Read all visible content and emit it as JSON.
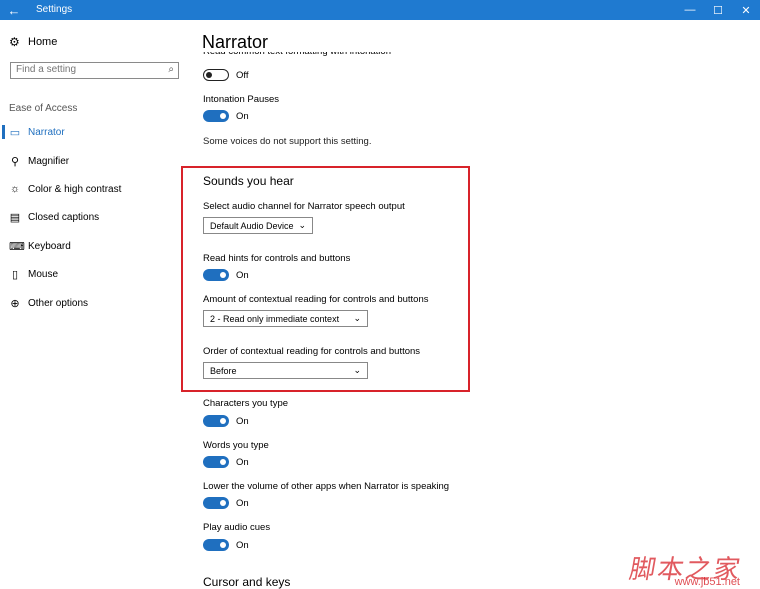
{
  "window": {
    "title": "Settings",
    "back_glyph": "←",
    "minimize": "—",
    "maximize": "☐",
    "close": "✕"
  },
  "sidebar": {
    "home_label": "Home",
    "search_placeholder": "Find a setting",
    "section_label": "Ease of Access",
    "items": [
      {
        "label": "Narrator",
        "icon": "narrator-icon",
        "active": true
      },
      {
        "label": "Magnifier",
        "icon": "magnifier-icon"
      },
      {
        "label": "Color & high contrast",
        "icon": "brightness-icon"
      },
      {
        "label": "Closed captions",
        "icon": "captions-icon"
      },
      {
        "label": "Keyboard",
        "icon": "keyboard-icon"
      },
      {
        "label": "Mouse",
        "icon": "mouse-icon"
      },
      {
        "label": "Other options",
        "icon": "options-icon"
      }
    ]
  },
  "main": {
    "title": "Narrator",
    "cut_text": "Read common text formatting with intonation",
    "top_toggle": {
      "state": "Off"
    },
    "intonation_label": "Intonation Pauses",
    "intonation_state": "On",
    "voices_note": "Some voices do not support this setting.",
    "sounds_heading": "Sounds you hear",
    "audio_channel_label": "Select audio channel for Narrator speech output",
    "audio_channel_value": "Default Audio Device",
    "hints_label": "Read hints for controls and buttons",
    "hints_state": "On",
    "amount_label": "Amount of contextual reading for controls and buttons",
    "amount_value": "2 - Read only immediate context",
    "order_label": "Order of contextual reading for controls and buttons",
    "order_value": "Before",
    "chars_label": "Characters you type",
    "chars_state": "On",
    "words_label": "Words you type",
    "words_state": "On",
    "lower_label": "Lower the volume of other apps when Narrator is speaking",
    "lower_state": "On",
    "cues_label": "Play audio cues",
    "cues_state": "On",
    "cursor_heading": "Cursor and keys"
  },
  "watermark": {
    "text": "脚本之家",
    "url": "www.jb51.net"
  },
  "colors": {
    "accent": "#1f6fbf",
    "titlebar": "#1f7ad0",
    "highlight": "#d8232a"
  }
}
